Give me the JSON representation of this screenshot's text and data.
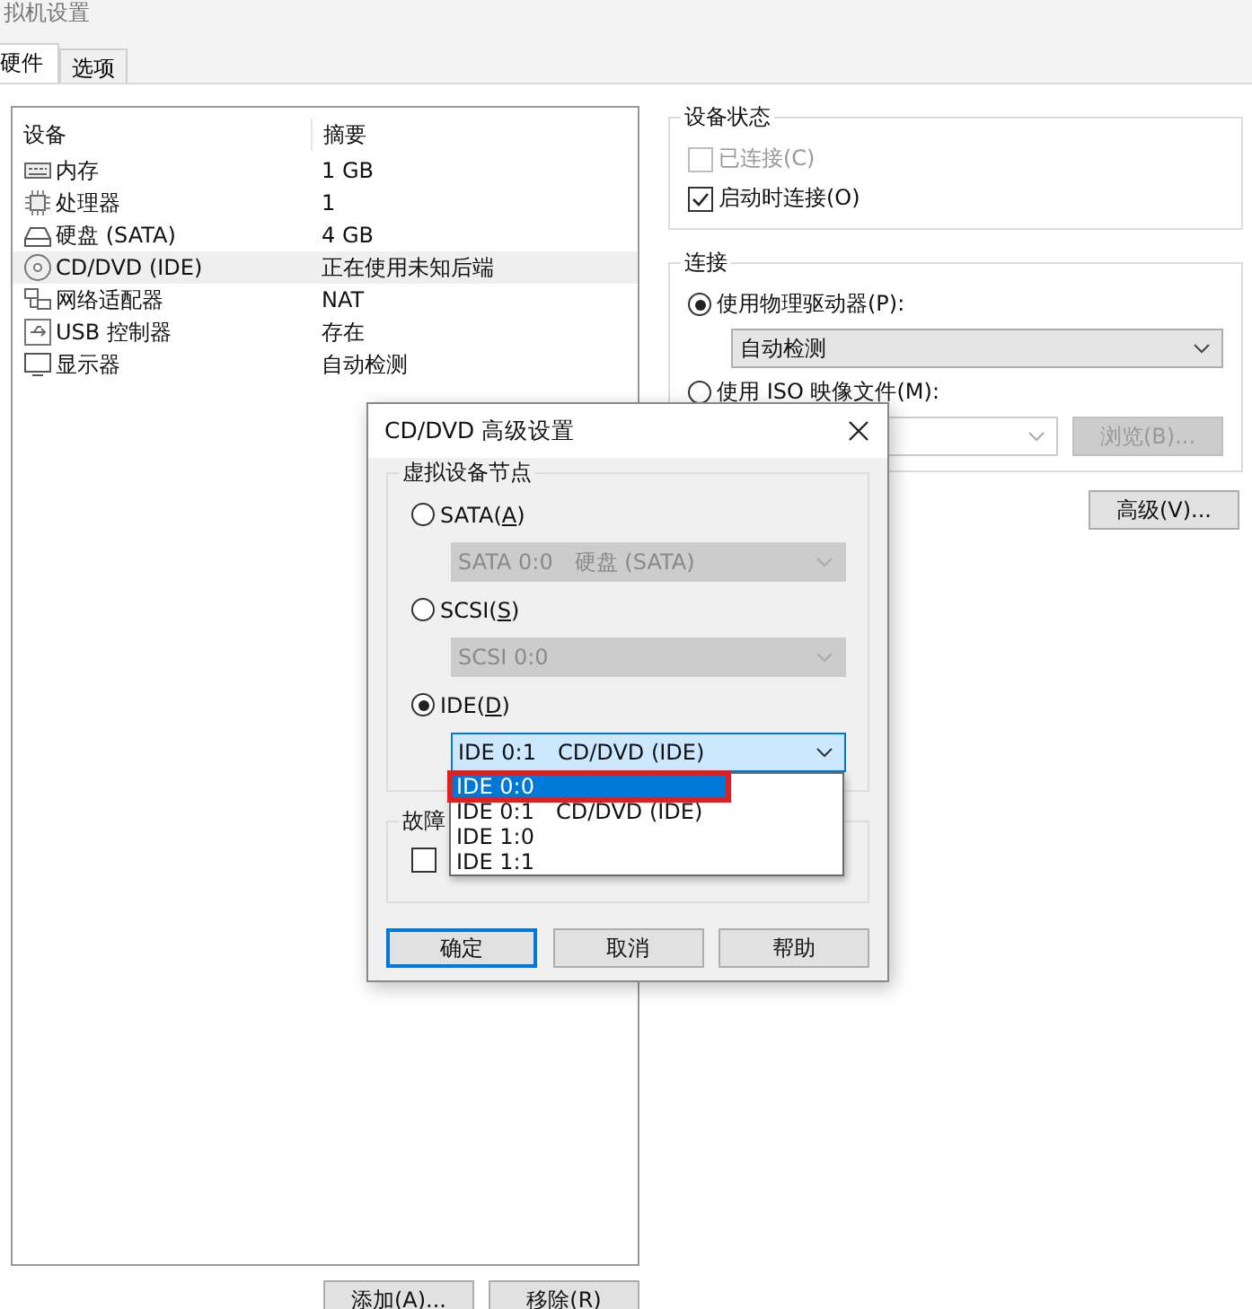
{
  "window": {
    "title": "拟机设置"
  },
  "tabs": [
    {
      "label": "硬件",
      "selected": true
    },
    {
      "label": "选项",
      "selected": false
    }
  ],
  "device_list": {
    "columns": [
      "设备",
      "摘要"
    ],
    "rows": [
      {
        "kind": "memory",
        "device": "内存",
        "summary": "1 GB",
        "selected": false
      },
      {
        "kind": "cpu",
        "device": "处理器",
        "summary": "1",
        "selected": false
      },
      {
        "kind": "disk",
        "device": "硬盘 (SATA)",
        "summary": "4 GB",
        "selected": false
      },
      {
        "kind": "cd",
        "device": "CD/DVD (IDE)",
        "summary": "正在使用未知后端",
        "selected": true
      },
      {
        "kind": "network",
        "device": "网络适配器",
        "summary": "NAT",
        "selected": false
      },
      {
        "kind": "usb",
        "device": "USB 控制器",
        "summary": "存在",
        "selected": false
      },
      {
        "kind": "monitor",
        "device": "显示器",
        "summary": "自动检测",
        "selected": false
      }
    ]
  },
  "device_status": {
    "title": "设备状态",
    "options": [
      {
        "label": "已连接(C)",
        "checked": false,
        "disabled": true
      },
      {
        "label": "启动时连接(O)",
        "checked": true,
        "disabled": false
      }
    ]
  },
  "connection": {
    "title": "连接",
    "options": [
      {
        "label": "使用物理驱动器(P):",
        "selected": true
      },
      {
        "label": "使用 ISO 映像文件(M):",
        "selected": false
      }
    ],
    "drive_select": {
      "value": "自动检测"
    },
    "browse_button": "浏览(B)..."
  },
  "advanced_button": "高级(V)...",
  "buttons": [
    "添加(A)...",
    "移除(R)"
  ],
  "dialog": {
    "title": "CD/DVD 高级设置",
    "node_group": {
      "title": "虚拟设备节点",
      "options": [
        {
          "label_parts": [
            "SATA(",
            "A",
            ")"
          ],
          "selected": false,
          "select_enabled": false,
          "value": [
            "SATA 0:0",
            "硬盘 (SATA)"
          ]
        },
        {
          "label_parts": [
            "SCSI(",
            "S",
            ")"
          ],
          "selected": false,
          "select_enabled": false,
          "value": [
            "SCSI 0:0"
          ]
        },
        {
          "label_parts": [
            "IDE(",
            "D",
            ")"
          ],
          "selected": true,
          "select_enabled": true,
          "value": [
            "IDE 0:1",
            "CD/DVD (IDE)"
          ]
        }
      ]
    },
    "dropdown_list": [
      {
        "values": [
          "IDE 0:0"
        ],
        "selected": true,
        "marked": true
      },
      {
        "values": [
          "IDE 0:1",
          "CD/DVD (IDE)"
        ],
        "selected": false,
        "marked": false
      },
      {
        "values": [
          "IDE 1:0"
        ],
        "selected": false,
        "marked": false
      },
      {
        "values": [
          "IDE 1:1"
        ],
        "selected": false,
        "marked": false
      }
    ],
    "fault_group": {
      "title": "故障",
      "checkbox": {
        "checked": false
      }
    },
    "buttons": [
      {
        "label": "确定",
        "default": true
      },
      {
        "label": "取消",
        "default": false
      },
      {
        "label": "帮助",
        "default": false
      }
    ]
  }
}
